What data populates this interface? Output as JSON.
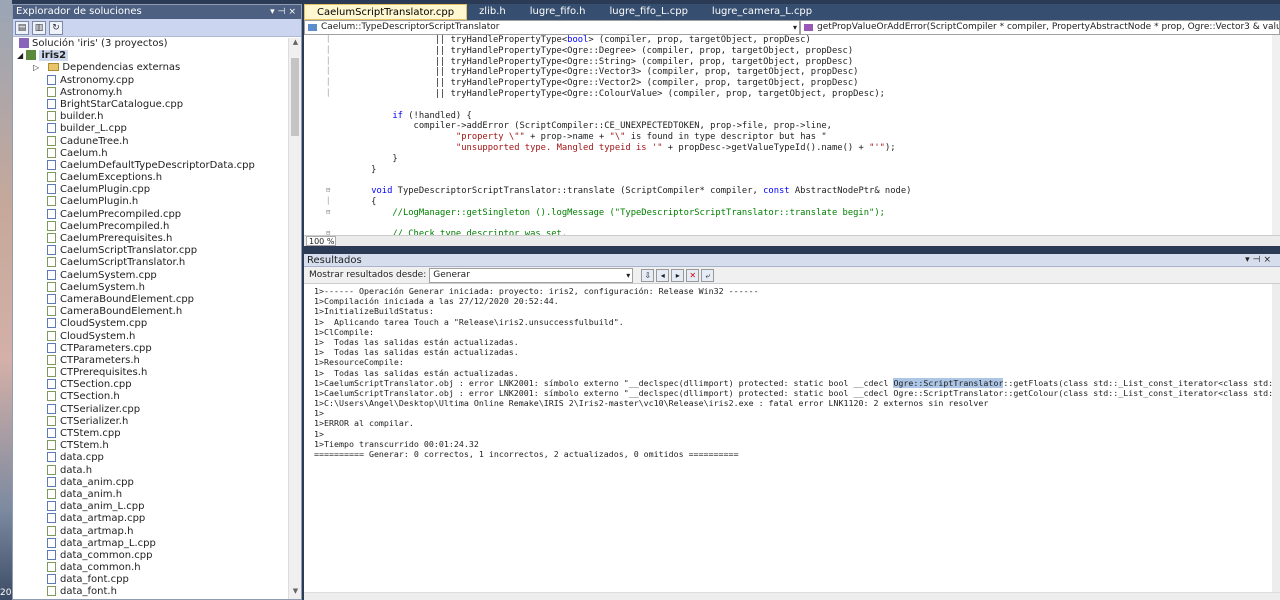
{
  "solution_explorer": {
    "title": "Explorador de soluciones",
    "solution_label": "Solución 'iris'  (3 proyectos)",
    "project_label": "iris2",
    "external_deps": "Dependencias externas",
    "files": [
      "Astronomy.cpp",
      "Astronomy.h",
      "BrightStarCatalogue.cpp",
      "builder.h",
      "builder_L.cpp",
      "CaduneTree.h",
      "Caelum.h",
      "CaelumDefaultTypeDescriptorData.cpp",
      "CaelumExceptions.h",
      "CaelumPlugin.cpp",
      "CaelumPlugin.h",
      "CaelumPrecompiled.cpp",
      "CaelumPrecompiled.h",
      "CaelumPrerequisites.h",
      "CaelumScriptTranslator.cpp",
      "CaelumScriptTranslator.h",
      "CaelumSystem.cpp",
      "CaelumSystem.h",
      "CameraBoundElement.cpp",
      "CameraBoundElement.h",
      "CloudSystem.cpp",
      "CloudSystem.h",
      "CTParameters.cpp",
      "CTParameters.h",
      "CTPrerequisites.h",
      "CTSection.cpp",
      "CTSection.h",
      "CTSerializer.cpp",
      "CTSerializer.h",
      "CTStem.cpp",
      "CTStem.h",
      "data.cpp",
      "data.h",
      "data_anim.cpp",
      "data_anim.h",
      "data_anim_L.cpp",
      "data_artmap.cpp",
      "data_artmap.h",
      "data_artmap_L.cpp",
      "data_common.cpp",
      "data_common.h",
      "data_font.cpp",
      "data_font.h"
    ],
    "bottom_number": "20"
  },
  "tabs": [
    "CaelumScriptTranslator.cpp",
    "zlib.h",
    "lugre_fifo.h",
    "lugre_fifo_L.cpp",
    "lugre_camera_L.cpp"
  ],
  "nav": {
    "left_combo": "Caelum::TypeDescriptorScriptTranslator",
    "right_combo": "getPropValueOrAddError(ScriptCompiler * compiler, PropertyAbstractNode * prop, Ogre::Vector3 & value)"
  },
  "code_lines": [
    "                || tryHandlePropertyType<bool> (compiler, prop, targetObject, propDesc)",
    "                || tryHandlePropertyType<Ogre::Degree> (compiler, prop, targetObject, propDesc)",
    "                || tryHandlePropertyType<Ogre::String> (compiler, prop, targetObject, propDesc)",
    "                || tryHandlePropertyType<Ogre::Vector3> (compiler, prop, targetObject, propDesc)",
    "                || tryHandlePropertyType<Ogre::Vector2> (compiler, prop, targetObject, propDesc)",
    "                || tryHandlePropertyType<Ogre::ColourValue> (compiler, prop, targetObject, propDesc);",
    "",
    "        if (!handled) {",
    "            compiler->addError (ScriptCompiler::CE_UNEXPECTEDTOKEN, prop->file, prop->line,",
    "                    \"property \\\"\" + prop->name + \"\\\" is found in type descriptor but has \"",
    "                    \"unsupported type. Mangled typeid is '\" + propDesc->getValueTypeId().name() + \"'\");",
    "        }",
    "    }",
    "",
    "    void TypeDescriptorScriptTranslator::translate (ScriptCompiler* compiler, const AbstractNodePtr& node)",
    "    {",
    "        //LogManager::getSingleton ().logMessage (\"TypeDescriptorScriptTranslator::translate begin\");",
    "",
    "        // Check type descriptor was set."
  ],
  "zoom": "100 %",
  "output": {
    "title": "Resultados",
    "show_from_label": "Mostrar resultados desde:",
    "show_from_value": "Generar",
    "lines": [
      "1>------ Operación Generar iniciada: proyecto: iris2, configuración: Release Win32 ------",
      "1>Compilación iniciada a las 27/12/2020 20:52:44.",
      "1>InitializeBuildStatus:",
      "1>  Aplicando tarea Touch a \"Release\\iris2.unsuccessfulbuild\".",
      "1>ClCompile:",
      "1>  Todas las salidas están actualizadas.",
      "1>  Todas las salidas están actualizadas.",
      "1>ResourceCompile:",
      "1>  Todas las salidas están actualizadas.",
      "1>CaelumScriptTranslator.obj : error LNK2001: símbolo externo \"__declspec(dllimport) protected: static bool __cdecl ",
      "1>CaelumScriptTranslator.obj : error LNK2001: símbolo externo \"__declspec(dllimport) protected: static bool __cdecl Ogre::ScriptTranslator::getColour(class std::_List_const_iterator<class std::_List_val<c",
      "1>C:\\Users\\Angel\\Desktop\\Ultima Online Remake\\IRIS 2\\Iris2-master\\vc10\\Release\\iris2.exe : fatal error LNK1120: 2 externos sin resolver",
      "1>",
      "1>ERROR al compilar.",
      "1>",
      "1>Tiempo transcurrido 00:01:24.32",
      "========== Generar: 0 correctos, 1 incorrectos, 2 actualizados, 0 omitidos =========="
    ],
    "highlight_text": "Ogre::ScriptTranslator",
    "line10_tail": "::getFloats(class std::_List_const_iterator<class std::_List_val<c"
  }
}
